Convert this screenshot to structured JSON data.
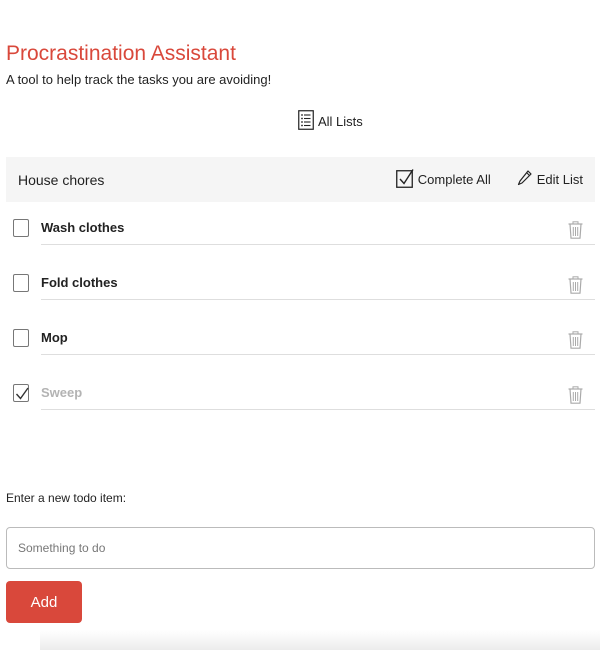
{
  "header": {
    "title": "Procrastination Assistant",
    "subtitle": "A tool to help track the tasks you are avoiding!"
  },
  "nav": {
    "all_lists_label": "All Lists",
    "all_lists_icon": "list-icon"
  },
  "list": {
    "name": "House chores",
    "complete_all_label": "Complete All",
    "complete_all_icon": "checked-box-icon",
    "edit_label": "Edit List",
    "edit_icon": "pencil-icon",
    "items": [
      {
        "text": "Wash clothes",
        "done": false
      },
      {
        "text": "Fold clothes",
        "done": false
      },
      {
        "text": "Mop",
        "done": false
      },
      {
        "text": "Sweep",
        "done": true
      }
    ],
    "delete_icon": "trash-icon"
  },
  "new_item": {
    "label": "Enter a new todo item:",
    "placeholder": "Something to do",
    "value": "",
    "add_label": "Add"
  },
  "colors": {
    "accent": "#d9483b",
    "header_bg": "#f5f5f5",
    "done_text": "#b3b3b3"
  }
}
